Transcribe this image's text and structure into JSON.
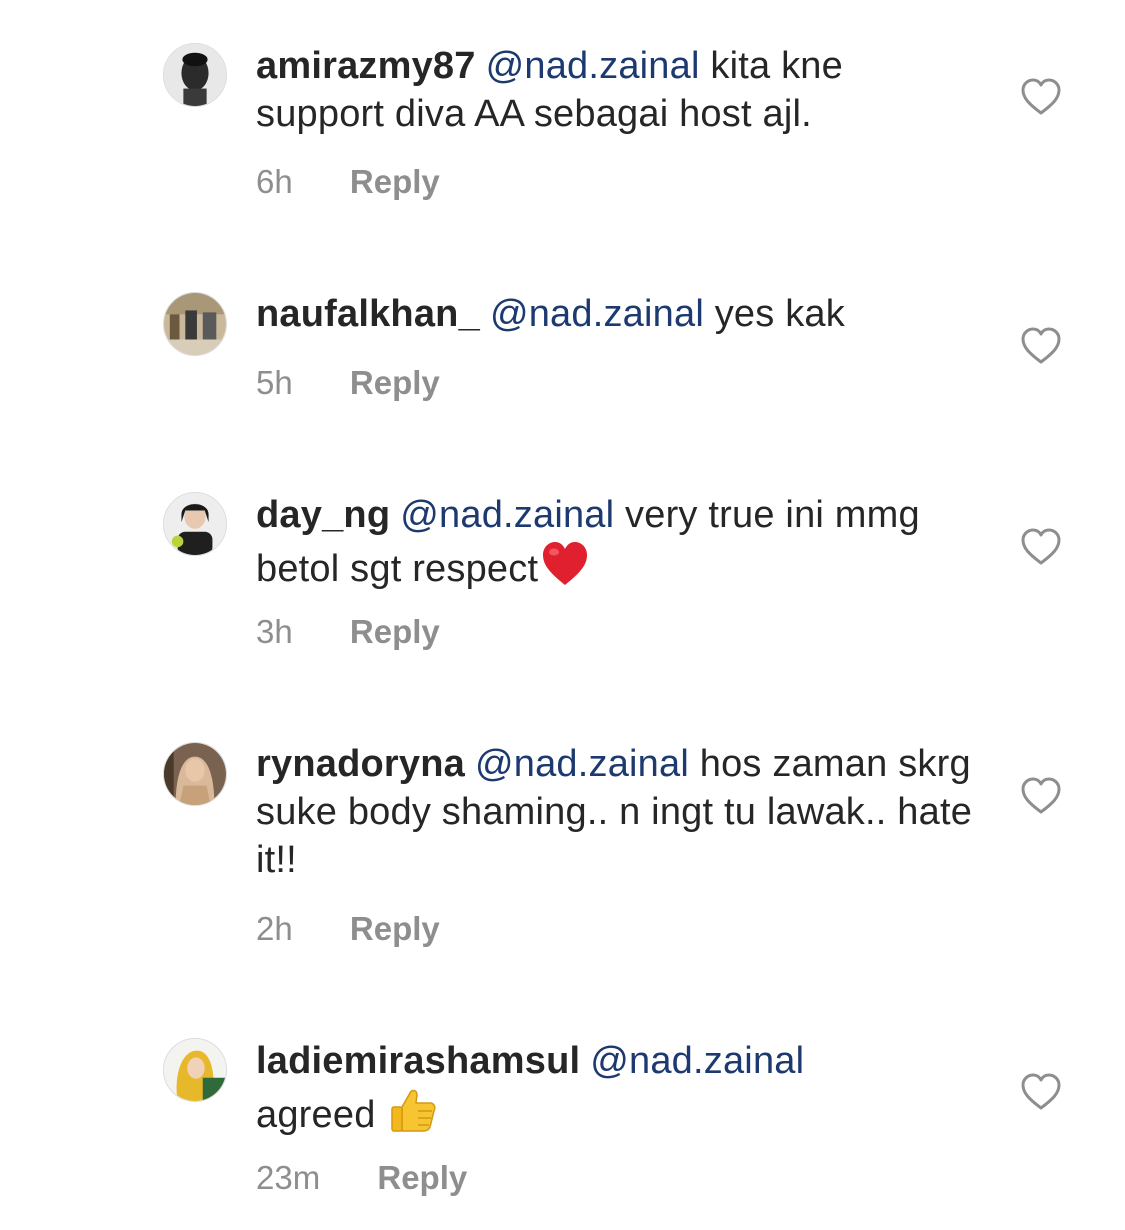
{
  "comments": [
    {
      "username": "amirazmy87",
      "mention": "@nad.zainal",
      "text": "kita kne support diva AA sebagai host ajl.",
      "emoji": "",
      "time": "6h",
      "reply_label": "Reply"
    },
    {
      "username": "naufalkhan_",
      "mention": "@nad.zainal",
      "text": "yes kak",
      "emoji": "",
      "time": "5h",
      "reply_label": "Reply"
    },
    {
      "username": "day_ng",
      "mention": "@nad.zainal",
      "text": "very true ini mmg betol sgt respect",
      "emoji": "red-heart-emoji",
      "time": "3h",
      "reply_label": "Reply"
    },
    {
      "username": "rynadoryna",
      "mention": "@nad.zainal",
      "text": "hos zaman skrg suke body shaming.. n ingt tu lawak.. hate it!!",
      "emoji": "",
      "time": "2h",
      "reply_label": "Reply"
    },
    {
      "username": "ladiemirashamsul",
      "mention": "@nad.zainal",
      "text": "agreed ",
      "emoji": "thumbs-up-emoji",
      "time": "23m",
      "reply_label": "Reply"
    }
  ],
  "icons": {
    "like": "heart-outline-icon"
  },
  "colors": {
    "text": "#262626",
    "mention": "#1c3a70",
    "secondary": "#8e8e8e"
  }
}
